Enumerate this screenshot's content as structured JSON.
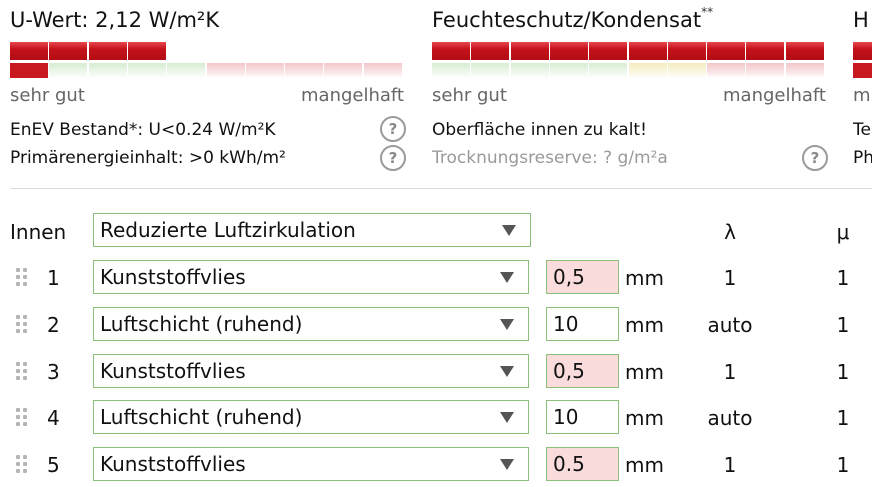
{
  "panels": [
    {
      "title": "U-Wert: 2,12 W/m²K",
      "title_sup": "",
      "range_left": "sehr gut",
      "range_right": "mangelhaft",
      "line1": "EnEV Bestand*: U<0.24 W/m²K",
      "line2": "Primärenergieinhalt: >0 kWh/m²",
      "scale_filled": 4,
      "scale_total": 10
    },
    {
      "title": "Feuchteschutz/Kondensat",
      "title_sup": "**",
      "range_left": "sehr gut",
      "range_right": "mangelhaft",
      "line1": "Oberfläche innen zu kalt!",
      "line2": "Trocknungsreserve: ? g/m²a",
      "scale_filled": 10,
      "scale_total": 10
    },
    {
      "title": "H",
      "range_left": "m",
      "line1": "Te",
      "line2": "Ph"
    }
  ],
  "table": {
    "inner_label": "Innen",
    "inner_select": "Reduzierte Luftzirkulation",
    "lambda_header": "λ",
    "mu_header": "μ",
    "rows": [
      {
        "num": "1",
        "material": "Kunststoffvlies",
        "thickness": "0,5",
        "unit": "mm",
        "lambda": "1",
        "mu": "1"
      },
      {
        "num": "2",
        "material": "Luftschicht (ruhend)",
        "thickness": "10",
        "unit": "mm",
        "lambda": "auto",
        "mu": "1"
      },
      {
        "num": "3",
        "material": "Kunststoffvlies",
        "thickness": "0,5",
        "unit": "mm",
        "lambda": "1",
        "mu": "1"
      },
      {
        "num": "4",
        "material": "Luftschicht (ruhend)",
        "thickness": "10",
        "unit": "mm",
        "lambda": "auto",
        "mu": "1"
      },
      {
        "num": "5",
        "material": "Kunststoffvlies",
        "thickness": "0.5",
        "unit": "mm",
        "lambda": "1",
        "mu": "1"
      }
    ]
  },
  "colors": {
    "accent_red": "#c4111a",
    "warn_bg": "#fbdcdc",
    "input_border": "#8cc07a"
  }
}
